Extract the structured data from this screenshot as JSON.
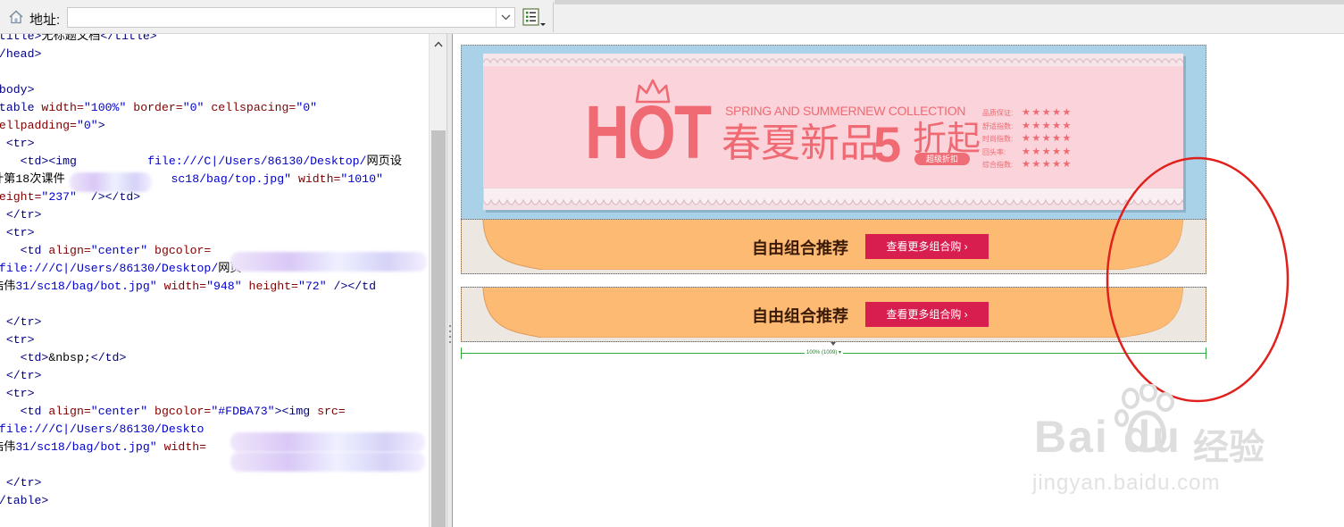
{
  "toolbar": {
    "address_label": "地址:",
    "address_value": ""
  },
  "code": {
    "lines": [
      [
        {
          "t": "<title>",
          "c": "tag"
        },
        {
          "t": "无标题文档",
          "c": "plain"
        },
        {
          "t": "</title>",
          "c": "tag"
        }
      ],
      [
        {
          "t": "</head>",
          "c": "tag"
        }
      ],
      [],
      [
        {
          "t": "<body>",
          "c": "tag"
        }
      ],
      [
        {
          "t": "<table ",
          "c": "tag"
        },
        {
          "t": "width=",
          "c": "attr"
        },
        {
          "t": "\"100%\" ",
          "c": "val"
        },
        {
          "t": "border=",
          "c": "attr"
        },
        {
          "t": "\"0\" ",
          "c": "val"
        },
        {
          "t": "cellspacing=",
          "c": "attr"
        },
        {
          "t": "\"0\"",
          "c": "val"
        }
      ],
      [
        {
          "t": "cellpadding=",
          "c": "attr"
        },
        {
          "t": "\"0\"",
          "c": "val"
        },
        {
          "t": ">",
          "c": "tag"
        }
      ],
      [
        {
          "t": "  <tr>",
          "c": "tag"
        }
      ],
      [
        {
          "t": "    <td>",
          "c": "tag"
        },
        {
          "t": "<img",
          "c": "tag"
        },
        {
          "t": "          ",
          "c": "plain"
        },
        {
          "t": "file:///C|/Users/86130/Desktop/",
          "c": "val"
        },
        {
          "t": "网页设",
          "c": "plain"
        }
      ],
      [
        {
          "t": "计第18次课件",
          "c": "plain"
        },
        {
          "t": "               ",
          "c": "plain"
        },
        {
          "t": "sc18/bag/top.jpg\" ",
          "c": "val"
        },
        {
          "t": "width=",
          "c": "attr"
        },
        {
          "t": "\"1010\"",
          "c": "val"
        }
      ],
      [
        {
          "t": "height=",
          "c": "attr"
        },
        {
          "t": "\"237\" ",
          "c": "val"
        },
        {
          "t": " />",
          "c": "tag"
        },
        {
          "t": "</td>",
          "c": "tag"
        }
      ],
      [
        {
          "t": "  </tr>",
          "c": "tag"
        }
      ],
      [
        {
          "t": "  <tr>",
          "c": "tag"
        }
      ],
      [
        {
          "t": "    <td ",
          "c": "tag"
        },
        {
          "t": "align=",
          "c": "attr"
        },
        {
          "t": "\"center\" ",
          "c": "val"
        },
        {
          "t": "bgcolor=",
          "c": "attr"
        }
      ],
      [
        {
          "t": "\"file:///C|/Users/86130/Desktop/",
          "c": "val"
        },
        {
          "t": "网页",
          "c": "plain"
        }
      ],
      [
        {
          "t": "浩伟",
          "c": "plain"
        },
        {
          "t": "31/sc18/bag/bot.jpg\" ",
          "c": "val"
        },
        {
          "t": "width=",
          "c": "attr"
        },
        {
          "t": "\"948\" ",
          "c": "val"
        },
        {
          "t": "height=",
          "c": "attr"
        },
        {
          "t": "\"72\" ",
          "c": "val"
        },
        {
          "t": "/></td",
          "c": "tag"
        }
      ],
      [
        {
          "t": ">",
          "c": "tag"
        }
      ],
      [
        {
          "t": "  </tr>",
          "c": "tag"
        }
      ],
      [
        {
          "t": "  <tr>",
          "c": "tag"
        }
      ],
      [
        {
          "t": "    <td>",
          "c": "tag"
        },
        {
          "t": "&nbsp;",
          "c": "plain"
        },
        {
          "t": "</td>",
          "c": "tag"
        }
      ],
      [
        {
          "t": "  </tr>",
          "c": "tag"
        }
      ],
      [
        {
          "t": "  <tr>",
          "c": "tag"
        }
      ],
      [
        {
          "t": "    <td ",
          "c": "tag"
        },
        {
          "t": "align=",
          "c": "attr"
        },
        {
          "t": "\"center\" ",
          "c": "val"
        },
        {
          "t": "bgcolor=",
          "c": "attr"
        },
        {
          "t": "\"#FDBA73\"",
          "c": "val"
        },
        {
          "t": "><img ",
          "c": "tag"
        },
        {
          "t": "src=",
          "c": "attr"
        }
      ],
      [
        {
          "t": "\"file:///C|/Users/86130/Deskto",
          "c": "val"
        }
      ],
      [
        {
          "t": "浩伟",
          "c": "plain"
        },
        {
          "t": "31/sc18/bag/bot.jpg\" ",
          "c": "val"
        },
        {
          "t": "width=",
          "c": "attr"
        }
      ],
      [
        {
          "t": ">",
          "c": "tag"
        }
      ],
      [
        {
          "t": "  </tr>",
          "c": "tag"
        }
      ],
      [
        {
          "t": "</table>",
          "c": "tag"
        }
      ]
    ]
  },
  "banner": {
    "hot": "HOT",
    "subtitle": "SPRING AND SUMMERNEW COLLECTION",
    "main_text": "春夏新品",
    "discount_number": "5",
    "discount_suffix": "折起",
    "badge": "超级折扣",
    "ratings": [
      {
        "label": "品质保证:",
        "stars": "★★★★★"
      },
      {
        "label": "舒适指数:",
        "stars": "★★★★★"
      },
      {
        "label": "时尚指数:",
        "stars": "★★★★★"
      },
      {
        "label": "回头率:",
        "stars": "★★★★★"
      },
      {
        "label": "综合指数:",
        "stars": "★★★★★"
      }
    ]
  },
  "combos": [
    {
      "title": "自由组合推荐",
      "button": "查看更多组合购 ›"
    },
    {
      "title": "自由组合推荐",
      "button": "查看更多组合购 ›"
    }
  ],
  "width_indicator": "100% (1009) ▾",
  "watermark": {
    "brand": "Bai  du",
    "cn": "经验",
    "url": "jingyan.baidu.com"
  },
  "colors": {
    "banner_bg": "#a9d1e8",
    "card_pink": "#fbd3da",
    "hot_red": "#ef6a72",
    "combo_orange": "#fdba73",
    "button_red": "#d81e4e",
    "annotation_red": "#e0201c"
  }
}
